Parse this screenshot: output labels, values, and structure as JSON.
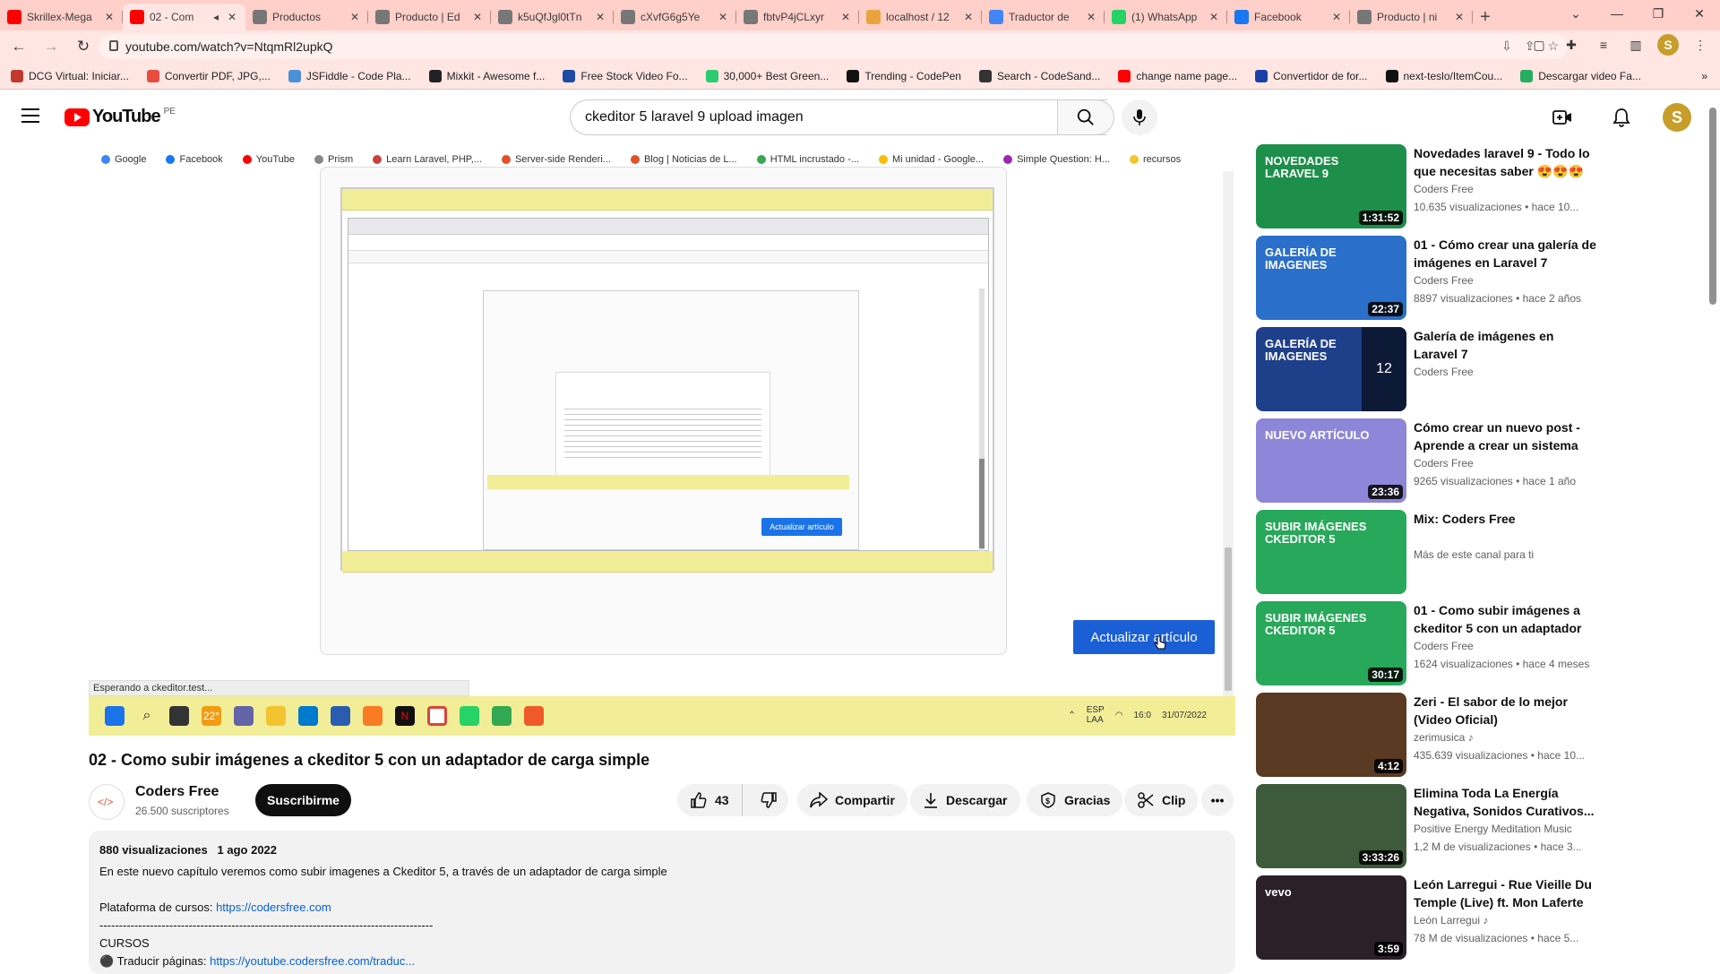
{
  "tabs": [
    {
      "label": "Skrillex-Mega",
      "icon_color": "#ff0000",
      "active": false
    },
    {
      "label": "02 - Com",
      "icon_color": "#ff0000",
      "active": true
    },
    {
      "label": "Productos",
      "icon_color": "#777777",
      "active": false
    },
    {
      "label": "Producto | Ed",
      "icon_color": "#777777",
      "active": false
    },
    {
      "label": "k5uQfJgl0tTn",
      "icon_color": "#777777",
      "active": false
    },
    {
      "label": "cXvfG6g5Ye",
      "icon_color": "#777777",
      "active": false
    },
    {
      "label": "fbtvP4jCLxyr",
      "icon_color": "#777777",
      "active": false
    },
    {
      "label": "localhost / 12",
      "icon_color": "#e8a33d",
      "active": false
    },
    {
      "label": "Traductor de",
      "icon_color": "#4285f4",
      "active": false
    },
    {
      "label": "(1) WhatsApp",
      "icon_color": "#25d366",
      "active": false
    },
    {
      "label": "Facebook",
      "icon_color": "#1877f2",
      "active": false
    },
    {
      "label": "Producto | ni",
      "icon_color": "#777777",
      "active": false
    }
  ],
  "new_tab": "+",
  "window_controls": [
    "⌄",
    "—",
    "❐",
    "✕"
  ],
  "address_bar": {
    "url": "youtube.com/watch?v=NtqmRl2upkQ"
  },
  "bookmarks": [
    {
      "label": "DCG Virtual: Iniciar...",
      "color": "#c0392b"
    },
    {
      "label": "Convertir PDF, JPG,...",
      "color": "#e74c3c"
    },
    {
      "label": "JSFiddle - Code Pla...",
      "color": "#4a90d9"
    },
    {
      "label": "Mixkit - Awesome f...",
      "color": "#222222"
    },
    {
      "label": "Free Stock Video Fo...",
      "color": "#1d4aa7"
    },
    {
      "label": "30,000+ Best Green...",
      "color": "#2ecc71"
    },
    {
      "label": "Trending - CodePen",
      "color": "#111111"
    },
    {
      "label": "Search - CodeSand...",
      "color": "#333333"
    },
    {
      "label": "change name page...",
      "color": "#ff0000"
    },
    {
      "label": "Convertidor de for...",
      "color": "#1a3ea8"
    },
    {
      "label": "next-teslo/ItemCou...",
      "color": "#111111"
    },
    {
      "label": "Descargar video Fa...",
      "color": "#27ae60"
    }
  ],
  "youtube": {
    "logo_text": "YouTube",
    "country_code": "PE",
    "search_query": "ckeditor 5 laravel 9 upload imagen"
  },
  "video_frame": {
    "bookmarks": [
      "Google",
      "Facebook",
      "YouTube",
      "Prism",
      "Learn Laravel, PHP,...",
      "Server-side Renderi...",
      "Blog | Noticias de L...",
      "HTML incrustado -...",
      "Mi unidad - Google...",
      "Simple Question: H...",
      "recursos"
    ],
    "inner_button": "Actualizar artículo",
    "update_button": "Actualizar artículo",
    "status_text": "Esperando a ckeditor.test...",
    "tray_lang": "ESP\nLAA",
    "tray_time": "16:0",
    "tray_date": "31/07/2022",
    "weather": "22°"
  },
  "video": {
    "title": "02 - Como subir imágenes a ckeditor 5 con un adaptador de carga simple",
    "channel": "Coders Free",
    "subscribers": "26.500 suscriptores",
    "subscribe_label": "Suscribirme",
    "likes": "43",
    "share_label": "Compartir",
    "download_label": "Descargar",
    "thanks_label": "Gracias",
    "clip_label": "Clip"
  },
  "description": {
    "views": "880 visualizaciones",
    "date": "1 ago 2022",
    "line1": "En este nuevo capítulo veremos como subir imagenes a Ckeditor 5, a través de un adaptador de carga simple",
    "platform_label": "Plataforma de cursos: ",
    "platform_link": "https://codersfree.com",
    "divider": "-------------------------------------------------------------------------------------------------------",
    "courses_label": "CURSOS",
    "course1_label": "⚫ Traducir páginas: ",
    "course1_link": "https://youtube.codersfree.com/traduc..."
  },
  "recommendations": [
    {
      "title": "Novedades laravel 9 - Todo lo que necesitas saber 😍😍😍",
      "channel": "Coders Free",
      "meta": "10.635 visualizaciones • hace 10...",
      "duration": "1:31:52",
      "thumb_bg": "#1e8f4a",
      "thumb_text": "NOVEDADES\nLARAVEL 9"
    },
    {
      "title": "01 - Cómo crear una galería de imágenes en Laravel 7",
      "channel": "Coders Free",
      "meta": "8897 visualizaciones • hace 2 años",
      "duration": "22:37",
      "thumb_bg": "#2a6fc9",
      "thumb_text": "GALERÍA DE\nIMAGENES"
    },
    {
      "title": "Galería de imágenes en Laravel 7",
      "channel": "Coders Free",
      "meta": "",
      "duration": "",
      "thumb_bg": "#1e3f8a",
      "thumb_text": "GALERÍA DE\nIMAGENES",
      "playlist_count": "12"
    },
    {
      "title": "Cómo crear un nuevo post - Aprende a crear un sistema de...",
      "channel": "Coders Free",
      "meta": "9265 visualizaciones • hace 1 año",
      "duration": "23:36",
      "thumb_bg": "#8e86d8",
      "thumb_text": "NUEVO ARTÍCULO"
    },
    {
      "title": "Mix: Coders Free",
      "channel": "Más de este canal para ti",
      "meta": "",
      "duration": "",
      "thumb_bg": "#28a85a",
      "thumb_text": "SUBIR IMÁGENES\nCKEDITOR 5"
    },
    {
      "title": "01 - Como subir imágenes a ckeditor 5 con un adaptador d...",
      "channel": "Coders Free",
      "meta": "1624 visualizaciones • hace 4 meses",
      "duration": "30:17",
      "thumb_bg": "#28a85a",
      "thumb_text": "SUBIR IMÁGENES\nCKEDITOR 5"
    },
    {
      "title": "Zeri - El sabor de lo mejor (Video Oficial)",
      "channel": "zerimusica ♪",
      "meta": "435.639 visualizaciones • hace 10...",
      "duration": "4:12",
      "thumb_bg": "#5a3a22",
      "thumb_text": ""
    },
    {
      "title": "Elimina Toda La Energía Negativa, Sonidos Curativos...",
      "channel": "Positive Energy Meditation Music",
      "meta": "1,2 M de visualizaciones • hace 3...",
      "duration": "3:33:26",
      "thumb_bg": "#3d5a3a",
      "thumb_text": ""
    },
    {
      "title": "León Larregui - Rue Vieille Du Temple (Live) ft. Mon Laferte",
      "channel": "León Larregui ♪",
      "meta": "78 M de visualizaciones • hace 5...",
      "duration": "3:59",
      "thumb_bg": "#2b1f28",
      "thumb_text": "vevo"
    }
  ]
}
